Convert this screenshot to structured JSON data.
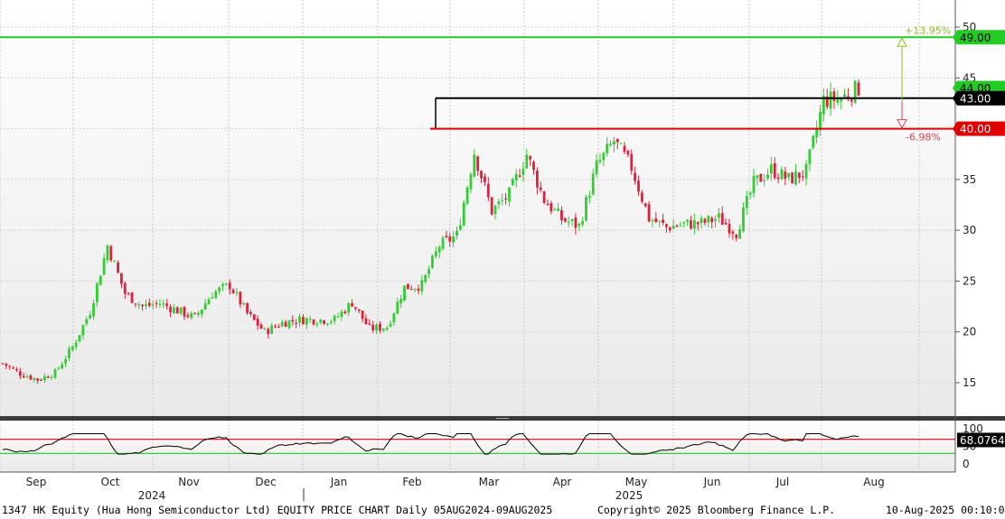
{
  "chart_data": {
    "type": "candlestick",
    "colors": {
      "up": "#33cc33",
      "down": "#e0203a",
      "line_green": "#22cc22",
      "line_black": "#000000",
      "line_red": "#e00000",
      "rsi": "#000000",
      "rsi_upper": "#e00000",
      "rsi_lower": "#22cc22",
      "upside": "#88c020",
      "downside": "#e04050"
    },
    "price_axis": {
      "ticks": [
        "15",
        "20",
        "25",
        "30",
        "35",
        "40",
        "45",
        "50"
      ],
      "ylim": [
        11,
        51
      ]
    },
    "month_labels": [
      "Sep",
      "Oct",
      "Nov",
      "Dec",
      "Jan",
      "Feb",
      "Mar",
      "Apr",
      "May",
      "Jun",
      "Jul",
      "Aug"
    ],
    "year_labels": [
      "2024",
      "2025"
    ],
    "levels": [
      {
        "name": "level-49",
        "value": 49.0,
        "label": "49.00",
        "color": "#22cc22"
      },
      {
        "name": "level-43",
        "value": 43.0,
        "label": "43.00",
        "color": "#000000"
      },
      {
        "name": "level-40",
        "value": 40.0,
        "label": "40.00",
        "color": "#e00000"
      }
    ],
    "last_price": {
      "value": 44.0,
      "label": "44.00"
    },
    "annotations": {
      "upside": "+13.95%",
      "downside": "-6.98%"
    },
    "rsi": {
      "ticks": [
        "100",
        "50",
        "0"
      ],
      "value_label": "68.0764",
      "upper": 70,
      "lower": 30,
      "ylim": [
        0,
        100
      ]
    },
    "weekly_closes": [
      16.9,
      15.9,
      15.3,
      16.0,
      18.5,
      22.0,
      28.5,
      23.8,
      22.5,
      22.8,
      22.1,
      21.4,
      23.8,
      24.6,
      21.8,
      20.0,
      20.9,
      21.2,
      21.2,
      21.2,
      22.9,
      20.3,
      20.5,
      24.4,
      24.6,
      28.5,
      29.5,
      37.7,
      31.9,
      33.5,
      37.5,
      33.0,
      31.1,
      30.4,
      36.3,
      38.8,
      36.2,
      31.2,
      30.3,
      30.6,
      30.7,
      31.2,
      29.8,
      34.6,
      36.0,
      35.0,
      35.8,
      42.8,
      43.0,
      44.0
    ]
  },
  "footer": {
    "title": "1347 HK Equity (Hua Hong Semiconductor Ltd) EQUITY PRICE CHART  Daily 05AUG2024-09AUG2025",
    "copyright": "Copyright© 2025 Bloomberg Finance L.P.",
    "timestamp": "10-Aug-2025 00:10:04"
  }
}
